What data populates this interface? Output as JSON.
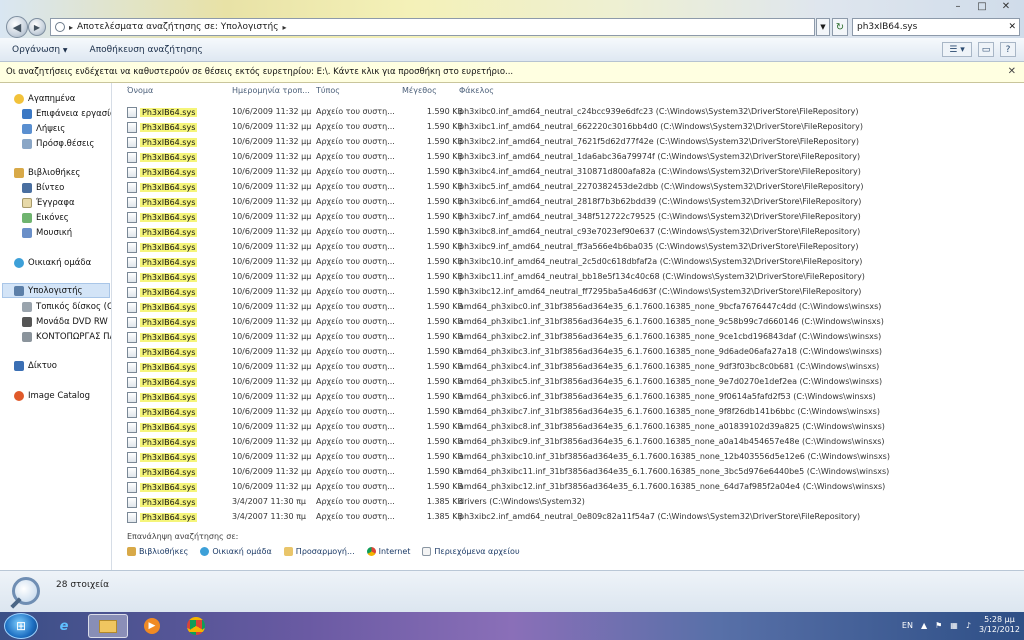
{
  "window": {
    "breadcrumb": [
      "Αποτελέσματα αναζήτησης σε: Υπολογιστής"
    ],
    "search_value": "ph3xIB64.sys",
    "controls": [
      "–",
      "□",
      "✕"
    ]
  },
  "toolbar": {
    "organize": "Οργάνωση",
    "save_search": "Αποθήκευση αναζήτησης"
  },
  "infobar": {
    "message": "Οι αναζητήσεις ενδέχεται να καθυστερούν σε θέσεις εκτός ευρετηρίου: E:\\. Κάντε κλικ για προσθήκη στο ευρετήριο..."
  },
  "nav": {
    "favorites": "Αγαπημένα",
    "desktop": "Επιφάνεια εργασίας",
    "downloads": "Λήψεις",
    "recent": "Πρόσφ.θέσεις",
    "libraries": "Βιβλιοθήκες",
    "videos": "Βίντεο",
    "documents": "Έγγραφα",
    "pictures": "Εικόνες",
    "music": "Μουσική",
    "homegroup": "Οικιακή ομάδα",
    "computer": "Υπολογιστής",
    "local_disk": "Τοπικός δίσκος (C:)",
    "dvd": "Μονάδα DVD RW (D",
    "kontopor": "ΚΟΝΤΟΠΩΡΓΑΣ ΠΑ",
    "network": "Δίκτυο",
    "image_catalog": "Image Catalog"
  },
  "columns": {
    "name": "Όνομα",
    "date": "Ημερομηνία τροπ...",
    "type": "Τύπος",
    "size": "Μέγεθος",
    "folder": "Φάκελος"
  },
  "files": [
    {
      "name": "Ph3xIB64.sys",
      "date": "10/6/2009 11:32 μμ",
      "type": "Αρχείο του συστη...",
      "size": "1.590 KB",
      "folder": "ph3xibc0.inf_amd64_neutral_c24bcc939e6dfc23 (C:\\Windows\\System32\\DriverStore\\FileRepository)"
    },
    {
      "name": "Ph3xIB64.sys",
      "date": "10/6/2009 11:32 μμ",
      "type": "Αρχείο του συστη...",
      "size": "1.590 KB",
      "folder": "ph3xibc1.inf_amd64_neutral_662220c3016bb4d0 (C:\\Windows\\System32\\DriverStore\\FileRepository)"
    },
    {
      "name": "Ph3xIB64.sys",
      "date": "10/6/2009 11:32 μμ",
      "type": "Αρχείο του συστη...",
      "size": "1.590 KB",
      "folder": "ph3xibc2.inf_amd64_neutral_7621f5d62d77f42e (C:\\Windows\\System32\\DriverStore\\FileRepository)"
    },
    {
      "name": "Ph3xIB64.sys",
      "date": "10/6/2009 11:32 μμ",
      "type": "Αρχείο του συστη...",
      "size": "1.590 KB",
      "folder": "ph3xibc3.inf_amd64_neutral_1da6abc36a79974f (C:\\Windows\\System32\\DriverStore\\FileRepository)"
    },
    {
      "name": "Ph3xIB64.sys",
      "date": "10/6/2009 11:32 μμ",
      "type": "Αρχείο του συστη...",
      "size": "1.590 KB",
      "folder": "ph3xibc4.inf_amd64_neutral_310871d800afa82a (C:\\Windows\\System32\\DriverStore\\FileRepository)"
    },
    {
      "name": "Ph3xIB64.sys",
      "date": "10/6/2009 11:32 μμ",
      "type": "Αρχείο του συστη...",
      "size": "1.590 KB",
      "folder": "ph3xibc5.inf_amd64_neutral_2270382453de2dbb (C:\\Windows\\System32\\DriverStore\\FileRepository)"
    },
    {
      "name": "Ph3xIB64.sys",
      "date": "10/6/2009 11:32 μμ",
      "type": "Αρχείο του συστη...",
      "size": "1.590 KB",
      "folder": "ph3xibc6.inf_amd64_neutral_2818f7b3b62bdd39 (C:\\Windows\\System32\\DriverStore\\FileRepository)"
    },
    {
      "name": "Ph3xIB64.sys",
      "date": "10/6/2009 11:32 μμ",
      "type": "Αρχείο του συστη...",
      "size": "1.590 KB",
      "folder": "ph3xibc7.inf_amd64_neutral_348f512722c79525 (C:\\Windows\\System32\\DriverStore\\FileRepository)"
    },
    {
      "name": "Ph3xIB64.sys",
      "date": "10/6/2009 11:32 μμ",
      "type": "Αρχείο του συστη...",
      "size": "1.590 KB",
      "folder": "ph3xibc8.inf_amd64_neutral_c93e7023ef90e637 (C:\\Windows\\System32\\DriverStore\\FileRepository)"
    },
    {
      "name": "Ph3xIB64.sys",
      "date": "10/6/2009 11:32 μμ",
      "type": "Αρχείο του συστη...",
      "size": "1.590 KB",
      "folder": "ph3xibc9.inf_amd64_neutral_ff3a566e4b6ba035 (C:\\Windows\\System32\\DriverStore\\FileRepository)"
    },
    {
      "name": "Ph3xIB64.sys",
      "date": "10/6/2009 11:32 μμ",
      "type": "Αρχείο του συστη...",
      "size": "1.590 KB",
      "folder": "ph3xibc10.inf_amd64_neutral_2c5d0c618dbfaf2a (C:\\Windows\\System32\\DriverStore\\FileRepository)"
    },
    {
      "name": "Ph3xIB64.sys",
      "date": "10/6/2009 11:32 μμ",
      "type": "Αρχείο του συστη...",
      "size": "1.590 KB",
      "folder": "ph3xibc11.inf_amd64_neutral_bb18e5f134c40c68 (C:\\Windows\\System32\\DriverStore\\FileRepository)"
    },
    {
      "name": "Ph3xIB64.sys",
      "date": "10/6/2009 11:32 μμ",
      "type": "Αρχείο του συστη...",
      "size": "1.590 KB",
      "folder": "ph3xibc12.inf_amd64_neutral_ff7295ba5a46d63f (C:\\Windows\\System32\\DriverStore\\FileRepository)"
    },
    {
      "name": "Ph3xIB64.sys",
      "date": "10/6/2009 11:32 μμ",
      "type": "Αρχείο του συστη...",
      "size": "1.590 KB",
      "folder": "amd64_ph3xibc0.inf_31bf3856ad364e35_6.1.7600.16385_none_9bcfa7676447c4dd (C:\\Windows\\winsxs)"
    },
    {
      "name": "Ph3xIB64.sys",
      "date": "10/6/2009 11:32 μμ",
      "type": "Αρχείο του συστη...",
      "size": "1.590 KB",
      "folder": "amd64_ph3xibc1.inf_31bf3856ad364e35_6.1.7600.16385_none_9c58b99c7d660146 (C:\\Windows\\winsxs)"
    },
    {
      "name": "Ph3xIB64.sys",
      "date": "10/6/2009 11:32 μμ",
      "type": "Αρχείο του συστη...",
      "size": "1.590 KB",
      "folder": "amd64_ph3xibc2.inf_31bf3856ad364e35_6.1.7600.16385_none_9ce1cbd196843daf (C:\\Windows\\winsxs)"
    },
    {
      "name": "Ph3xIB64.sys",
      "date": "10/6/2009 11:32 μμ",
      "type": "Αρχείο του συστη...",
      "size": "1.590 KB",
      "folder": "amd64_ph3xibc3.inf_31bf3856ad364e35_6.1.7600.16385_none_9d6ade06afa27a18 (C:\\Windows\\winsxs)"
    },
    {
      "name": "Ph3xIB64.sys",
      "date": "10/6/2009 11:32 μμ",
      "type": "Αρχείο του συστη...",
      "size": "1.590 KB",
      "folder": "amd64_ph3xibc4.inf_31bf3856ad364e35_6.1.7600.16385_none_9df3f03bc8c0b681 (C:\\Windows\\winsxs)"
    },
    {
      "name": "Ph3xIB64.sys",
      "date": "10/6/2009 11:32 μμ",
      "type": "Αρχείο του συστη...",
      "size": "1.590 KB",
      "folder": "amd64_ph3xibc5.inf_31bf3856ad364e35_6.1.7600.16385_none_9e7d0270e1def2ea (C:\\Windows\\winsxs)"
    },
    {
      "name": "Ph3xIB64.sys",
      "date": "10/6/2009 11:32 μμ",
      "type": "Αρχείο του συστη...",
      "size": "1.590 KB",
      "folder": "amd64_ph3xibc6.inf_31bf3856ad364e35_6.1.7600.16385_none_9f0614a5fafd2f53 (C:\\Windows\\winsxs)"
    },
    {
      "name": "Ph3xIB64.sys",
      "date": "10/6/2009 11:32 μμ",
      "type": "Αρχείο του συστη...",
      "size": "1.590 KB",
      "folder": "amd64_ph3xibc7.inf_31bf3856ad364e35_6.1.7600.16385_none_9f8f26db141b6bbc (C:\\Windows\\winsxs)"
    },
    {
      "name": "Ph3xIB64.sys",
      "date": "10/6/2009 11:32 μμ",
      "type": "Αρχείο του συστη...",
      "size": "1.590 KB",
      "folder": "amd64_ph3xibc8.inf_31bf3856ad364e35_6.1.7600.16385_none_a01839102d39a825 (C:\\Windows\\winsxs)"
    },
    {
      "name": "Ph3xIB64.sys",
      "date": "10/6/2009 11:32 μμ",
      "type": "Αρχείο του συστη...",
      "size": "1.590 KB",
      "folder": "amd64_ph3xibc9.inf_31bf3856ad364e35_6.1.7600.16385_none_a0a14b454657e48e (C:\\Windows\\winsxs)"
    },
    {
      "name": "Ph3xIB64.sys",
      "date": "10/6/2009 11:32 μμ",
      "type": "Αρχείο του συστη...",
      "size": "1.590 KB",
      "folder": "amd64_ph3xibc10.inf_31bf3856ad364e35_6.1.7600.16385_none_12b403556d5e12e6 (C:\\Windows\\winsxs)"
    },
    {
      "name": "Ph3xIB64.sys",
      "date": "10/6/2009 11:32 μμ",
      "type": "Αρχείο του συστη...",
      "size": "1.590 KB",
      "folder": "amd64_ph3xibc11.inf_31bf3856ad364e35_6.1.7600.16385_none_3bc5d976e6440be5 (C:\\Windows\\winsxs)"
    },
    {
      "name": "Ph3xIB64.sys",
      "date": "10/6/2009 11:32 μμ",
      "type": "Αρχείο του συστη...",
      "size": "1.590 KB",
      "folder": "amd64_ph3xibc12.inf_31bf3856ad364e35_6.1.7600.16385_none_64d7af985f2a04e4 (C:\\Windows\\winsxs)"
    },
    {
      "name": "Ph3xIB64.sys",
      "date": "3/4/2007 11:30 πμ",
      "type": "Αρχείο του συστη...",
      "size": "1.385 KB",
      "folder": "drivers (C:\\Windows\\System32)"
    },
    {
      "name": "Ph3xIB64.sys",
      "date": "3/4/2007 11:30 πμ",
      "type": "Αρχείο του συστη...",
      "size": "1.385 KB",
      "folder": "ph3xibc2.inf_amd64_neutral_0e809c82a11f54a7 (C:\\Windows\\System32\\DriverStore\\FileRepository)"
    }
  ],
  "search_again": {
    "label": "Επανάληψη αναζήτησης σε:",
    "libraries": "Βιβλιοθήκες",
    "homegroup": "Οικιακή ομάδα",
    "custom": "Προσαρμογή...",
    "internet": "Internet",
    "file_contents": "Περιεχόμενα αρχείου"
  },
  "details": {
    "count": "28 στοιχεία"
  },
  "taskbar": {
    "lang": "EN",
    "time": "5:28 μμ",
    "date": "3/12/2012"
  }
}
